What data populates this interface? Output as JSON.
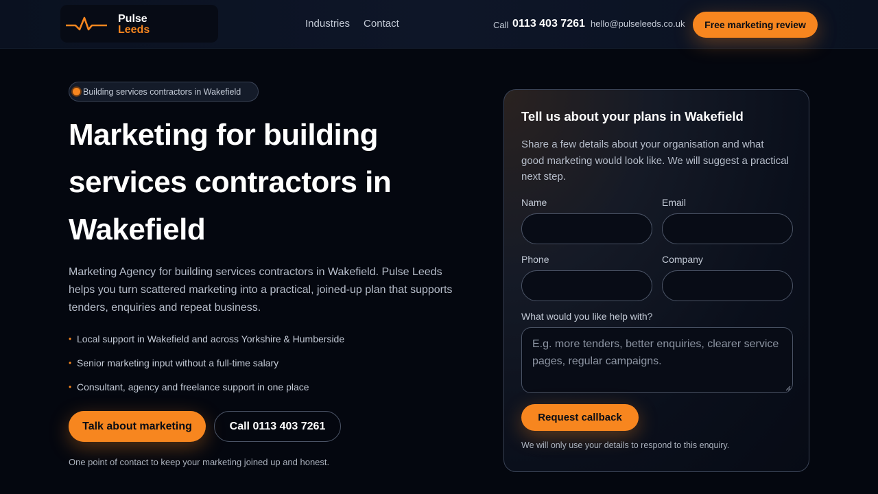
{
  "brand": {
    "name_line1": "Pulse",
    "name_line2": "Leeds",
    "logo_icon": "pulse-wave-icon",
    "accent_color": "#f7861f"
  },
  "nav": {
    "links": [
      "Industries",
      "Contact"
    ],
    "call_label": "Call",
    "phone": "0113 403 7261",
    "email": "hello@pulseleeds.co.uk",
    "cta": "Free marketing review"
  },
  "hero": {
    "badge": "Building services contractors in Wakefield",
    "title": "Marketing for building services contractors in Wakefield",
    "description": "Marketing Agency for building services contractors in Wakefield. Pulse Leeds helps you turn scattered marketing into a practical, joined-up plan that supports tenders, enquiries and repeat business.",
    "bullets": [
      "Local support in Wakefield and across Yorkshire & Humberside",
      "Senior marketing input without a full-time salary",
      "Consultant, agency and freelance support in one place"
    ],
    "bullet_glyph": "•",
    "primary_cta": "Talk about marketing",
    "secondary_cta": "Call 0113 403 7261",
    "note": "One point of contact to keep your marketing joined up and honest."
  },
  "form": {
    "title": "Tell us about your plans in Wakefield",
    "description": "Share a few details about your organisation and what good marketing would look like. We will suggest a practical next step.",
    "labels": {
      "name": "Name",
      "email": "Email",
      "phone": "Phone",
      "company": "Company",
      "help": "What would you like help with?"
    },
    "values": {
      "name": "",
      "email": "",
      "phone": "",
      "company": ""
    },
    "help_placeholder": "E.g. more tenders, better enquiries, clearer service pages, regular campaigns.",
    "submit": "Request callback",
    "privacy_note": "We will only use your details to respond to this enquiry."
  }
}
